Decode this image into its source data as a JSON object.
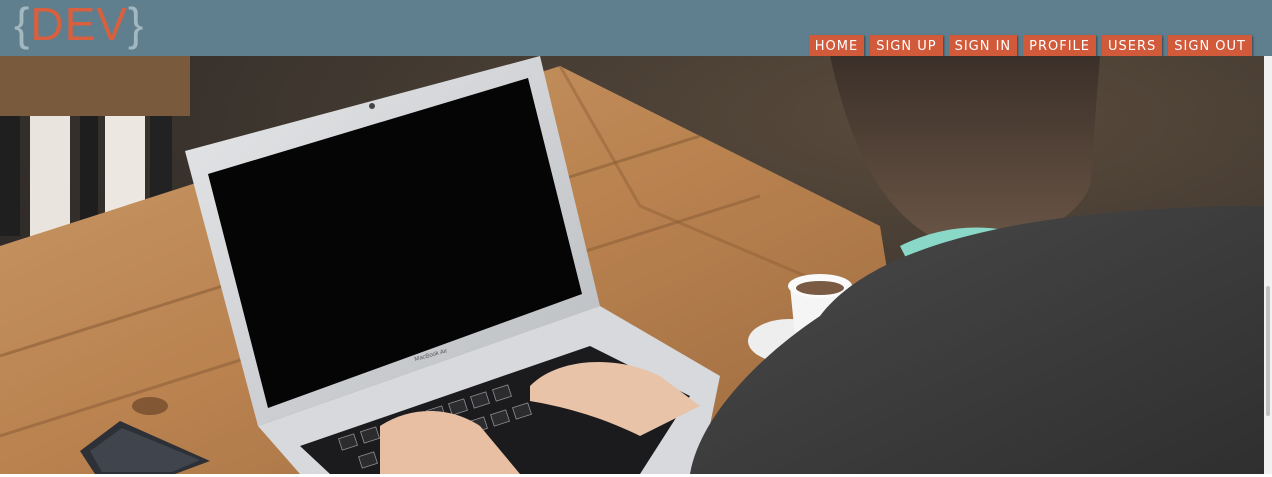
{
  "header": {
    "logo": {
      "open_brace": "{",
      "text": "DEV",
      "close_brace": "}"
    },
    "nav_items": [
      "HOME",
      "SIGN UP",
      "SIGN IN",
      "PROFILE",
      "USERS",
      "SIGN OUT"
    ]
  },
  "hero": {
    "laptop_brand": "MacBook Air"
  },
  "colors": {
    "header_bg": "#5f7f8e",
    "accent": "#d15a3a",
    "logo_brace": "#a3b7bf"
  },
  "icons": [
    "laptop-image",
    "coffee-cup",
    "smartphone"
  ]
}
